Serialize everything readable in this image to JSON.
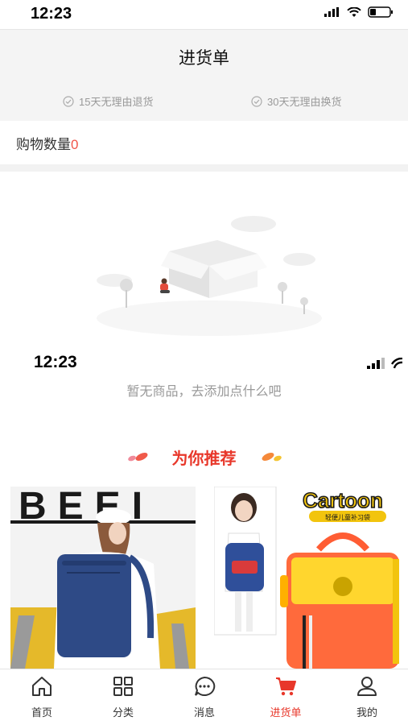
{
  "status_bar": {
    "time": "12:23"
  },
  "header": {
    "title": "进货单"
  },
  "guarantees": [
    {
      "label": "15天无理由退货",
      "icon": "check-circle-icon"
    },
    {
      "label": "30天无理由换货",
      "icon": "check-circle-icon"
    }
  ],
  "cart": {
    "count_label": "购物数量",
    "count": "0"
  },
  "overlay_status": {
    "time": "12:23"
  },
  "empty_state": {
    "message": "暂无商品，去添加点什么吧"
  },
  "recommend": {
    "title": "为你推荐"
  },
  "products": [
    {
      "banner_text": "BEEI"
    },
    {
      "brand": "Cartoon",
      "subtitle": "轻便儿童补习袋"
    }
  ],
  "tabbar": [
    {
      "label": "首页",
      "icon": "home-icon"
    },
    {
      "label": "分类",
      "icon": "grid-icon"
    },
    {
      "label": "消息",
      "icon": "message-icon"
    },
    {
      "label": "进货单",
      "icon": "cart-icon",
      "active": true
    },
    {
      "label": "我的",
      "icon": "user-icon"
    }
  ],
  "colors": {
    "accent": "#e8372a",
    "muted": "#999999",
    "header_bg": "#f4f4f4"
  }
}
